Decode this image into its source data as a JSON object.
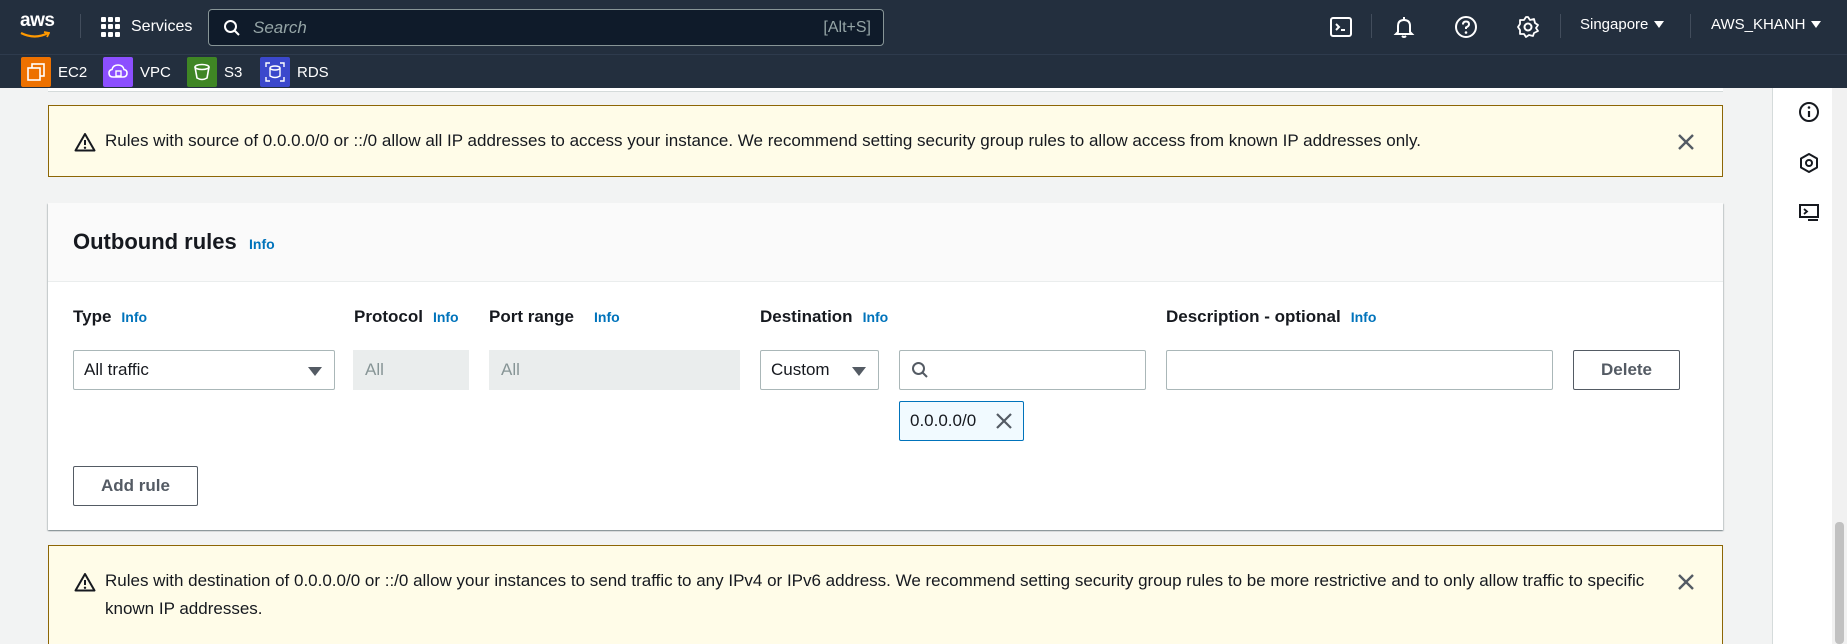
{
  "topnav": {
    "logo_text": "aws",
    "services_label": "Services",
    "search_placeholder": "Search",
    "search_shortcut": "[Alt+S]",
    "region": "Singapore",
    "account": "AWS_KHANH"
  },
  "favorites": [
    {
      "label": "EC2",
      "color": "#ed7100"
    },
    {
      "label": "VPC",
      "color": "#8c4fff"
    },
    {
      "label": "S3",
      "color": "#3f8624"
    },
    {
      "label": "RDS",
      "color": "#3b48cc"
    }
  ],
  "alerts": {
    "inbound_warning": "Rules with source of 0.0.0.0/0 or ::/0 allow all IP addresses to access your instance. We recommend setting security group rules to allow access from known IP addresses only.",
    "outbound_warning": "Rules with destination of 0.0.0.0/0 or ::/0 allow your instances to send traffic to any IPv4 or IPv6 address. We recommend setting security group rules to be more restrictive and to only allow traffic to specific known IP addresses."
  },
  "outbound": {
    "title": "Outbound rules",
    "info": "Info",
    "columns": {
      "type": "Type",
      "protocol": "Protocol",
      "port_range": "Port range",
      "destination": "Destination",
      "description": "Description - optional"
    },
    "rule": {
      "type": "All traffic",
      "protocol": "All",
      "port_range": "All",
      "destination_type": "Custom",
      "destination_token": "0.0.0.0/0",
      "description": ""
    },
    "delete_label": "Delete",
    "add_rule_label": "Add rule"
  },
  "colors": {
    "nav_bg": "#232f3e",
    "link": "#0073bb",
    "warning_bg": "#fffce8",
    "warning_border": "#8d6605"
  }
}
